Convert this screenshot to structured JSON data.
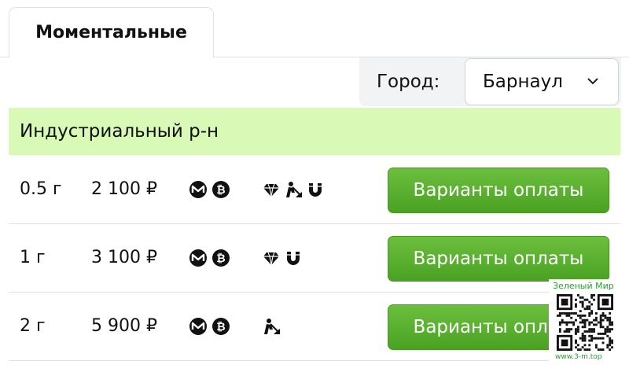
{
  "tabs": {
    "active_label": "Моментальные"
  },
  "city": {
    "label": "Город:",
    "selected": "Барнаул"
  },
  "district": "Индустриальный р-н",
  "pay_button_label": "Варианты оплаты",
  "rows": [
    {
      "weight": "0.5 г",
      "price": "2 100 ₽",
      "coins": [
        "monero-icon",
        "bitcoin-icon"
      ],
      "types": [
        "diamond-icon",
        "digging-person-icon",
        "magnet-icon"
      ]
    },
    {
      "weight": "1 г",
      "price": "3 100 ₽",
      "coins": [
        "monero-icon",
        "bitcoin-icon"
      ],
      "types": [
        "diamond-icon",
        "magnet-icon"
      ]
    },
    {
      "weight": "2 г",
      "price": "5 900 ₽",
      "coins": [
        "monero-icon",
        "bitcoin-icon"
      ],
      "types": [
        "digging-person-icon"
      ]
    }
  ],
  "watermark": {
    "title": "Зеленый Мир",
    "url": "www.3-m.top"
  },
  "colors": {
    "accent_green": "#5cb130",
    "district_bg": "#d9f9b6",
    "watermark_green": "#26a02a"
  }
}
